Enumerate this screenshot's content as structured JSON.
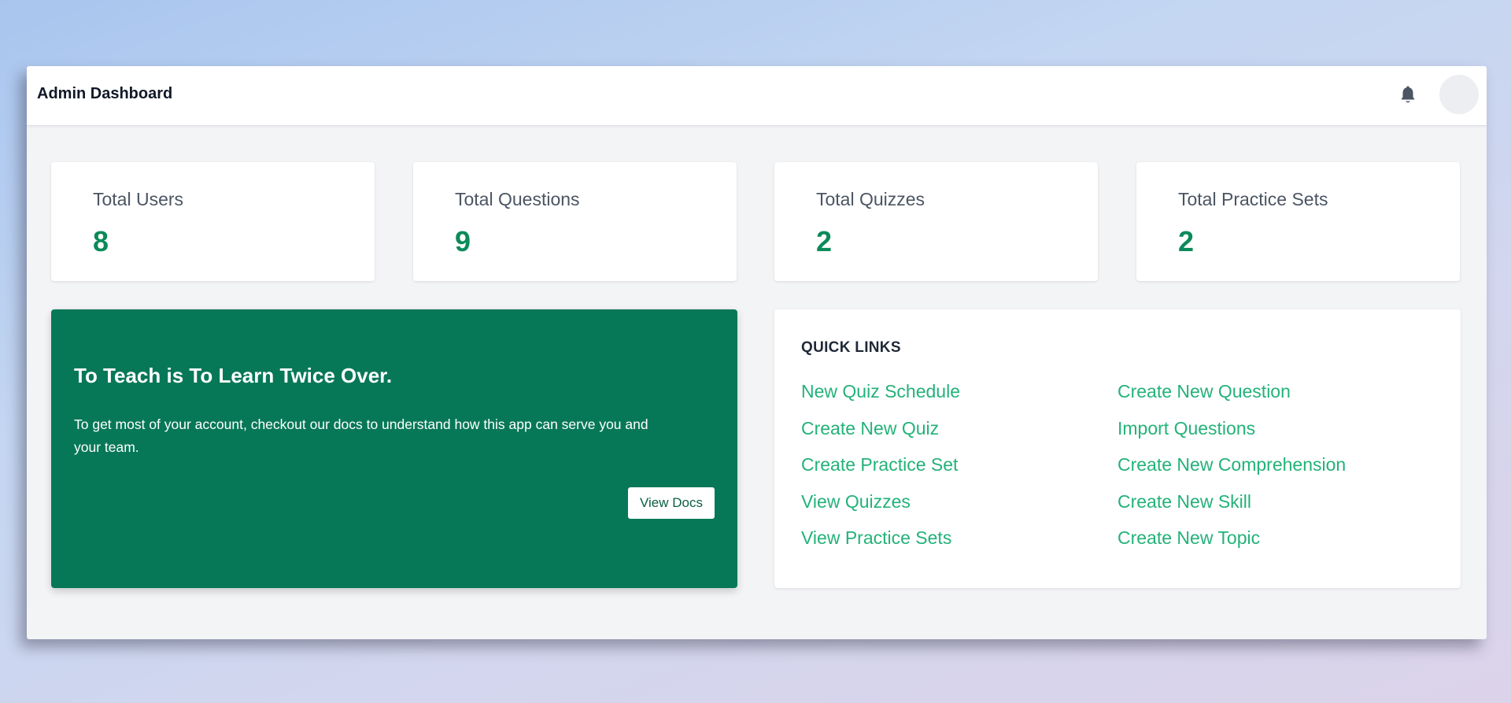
{
  "header": {
    "title": "Admin Dashboard",
    "bell_icon": "bell-icon",
    "avatar_icon": "avatar"
  },
  "stats": [
    {
      "label": "Total Users",
      "value": "8"
    },
    {
      "label": "Total Questions",
      "value": "9"
    },
    {
      "label": "Total Quizzes",
      "value": "2"
    },
    {
      "label": "Total Practice Sets",
      "value": "2"
    }
  ],
  "promo": {
    "heading": "To Teach is To Learn Twice Over.",
    "text": "To get most of your account, checkout our docs to understand how this app can serve you and your team.",
    "button_label": "View Docs"
  },
  "quick_links": {
    "title": "QUICK LINKS",
    "left": [
      "New Quiz Schedule",
      "Create New Quiz",
      "Create Practice Set",
      "View Quizzes",
      "View Practice Sets"
    ],
    "right": [
      "Create New Question",
      "Import Questions",
      "Create New Comprehension",
      "Create New Skill",
      "Create New Topic"
    ]
  },
  "colors": {
    "accent_green": "#077857",
    "stat_value_green": "#0b8a5a",
    "link_green": "#23b27a",
    "page_bg": "#f3f4f6"
  }
}
